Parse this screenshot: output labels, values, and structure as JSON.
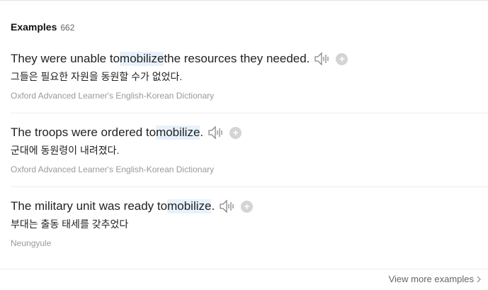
{
  "section": {
    "title": "Examples",
    "count": "662"
  },
  "examples": [
    {
      "before": "They were unable to ",
      "highlight": "mobilize",
      "after": " the resources they needed.",
      "translation": "그들은 필요한 자원을 동원할 수가 없었다.",
      "source": "Oxford Advanced Learner's English-Korean Dictionary"
    },
    {
      "before": "The troops were ordered to ",
      "highlight": "mobilize",
      "after": ".",
      "translation": "군대에 동원령이 내려졌다.",
      "source": "Oxford Advanced Learner's English-Korean Dictionary"
    },
    {
      "before": "The military unit was ready to ",
      "highlight": "mobilize",
      "after": ".",
      "translation": "부대는 출동 태세를 갖추었다",
      "source": "Neungyule"
    }
  ],
  "footer": {
    "view_more_label": "View more examples"
  },
  "icons": {
    "speaker": "speaker-icon",
    "add": "add-icon",
    "chevron": "chevron-right-icon"
  },
  "colors": {
    "highlight": "#e8f2fc",
    "source_text": "#999999",
    "add_button": "#d4d4d4"
  }
}
